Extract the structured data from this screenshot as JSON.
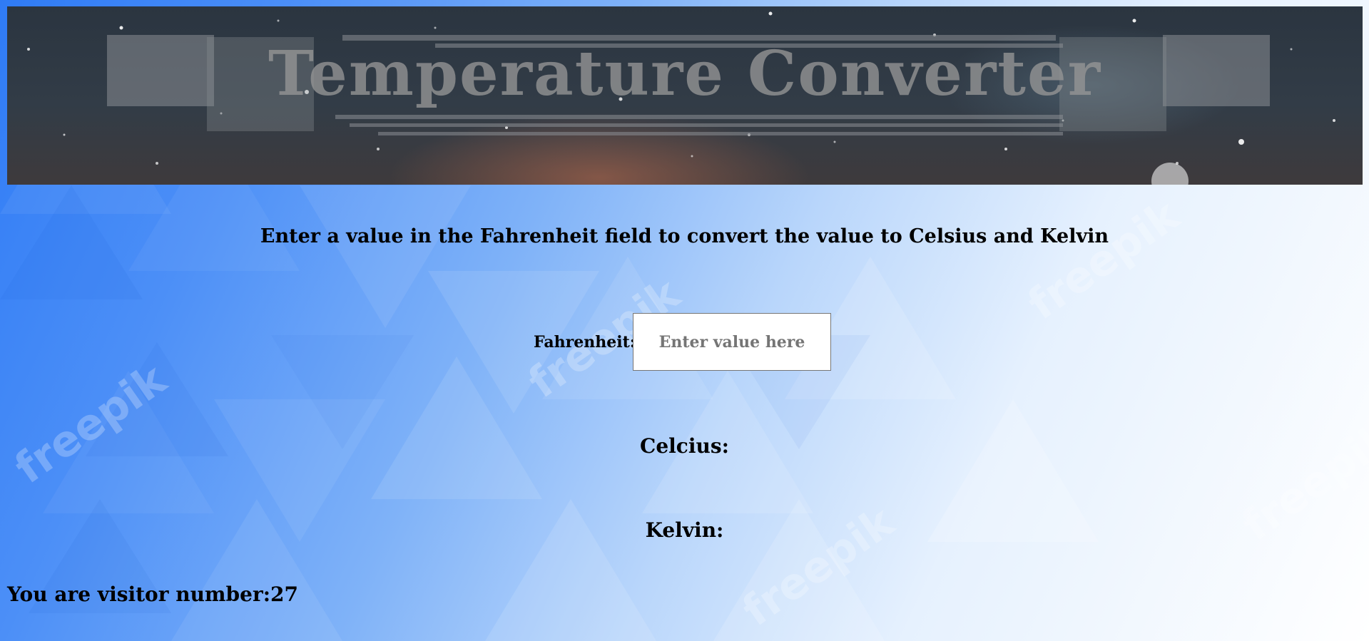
{
  "banner": {
    "title": "Temperature Converter"
  },
  "instruction": "Enter a value in the Fahrenheit field to convert the value to Celsius and Kelvin",
  "fahrenheit": {
    "label": "Fahrenheit:",
    "placeholder": "Enter value here",
    "value": ""
  },
  "celsius": {
    "label": "Celcius:"
  },
  "kelvin": {
    "label": "Kelvin:"
  },
  "visitor": {
    "label": "You are visitor number:",
    "count": "27"
  },
  "colors": {
    "background_accent": "#2f7bf5",
    "banner_bg": "#323c47",
    "text": "#000000"
  }
}
